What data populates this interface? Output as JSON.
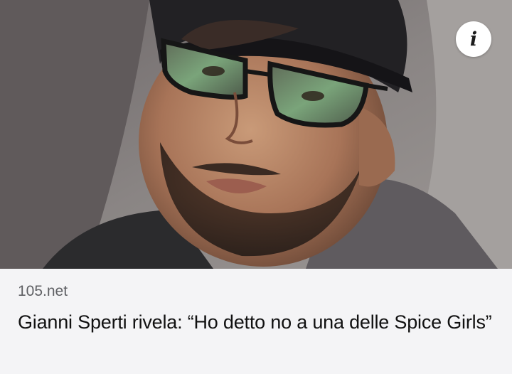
{
  "post": {
    "image_alt": "Selfie of a man with a beard, dark cap and black-framed glasses",
    "info_icon": "info-icon",
    "info_glyph": "i",
    "source": "105.net",
    "headline": "Gianni Sperti rivela: “Ho detto no a una delle Spice Girls”"
  },
  "colors": {
    "caption_background": "#f4f4f6",
    "source_text": "#5f6064",
    "headline_text": "#111111"
  }
}
